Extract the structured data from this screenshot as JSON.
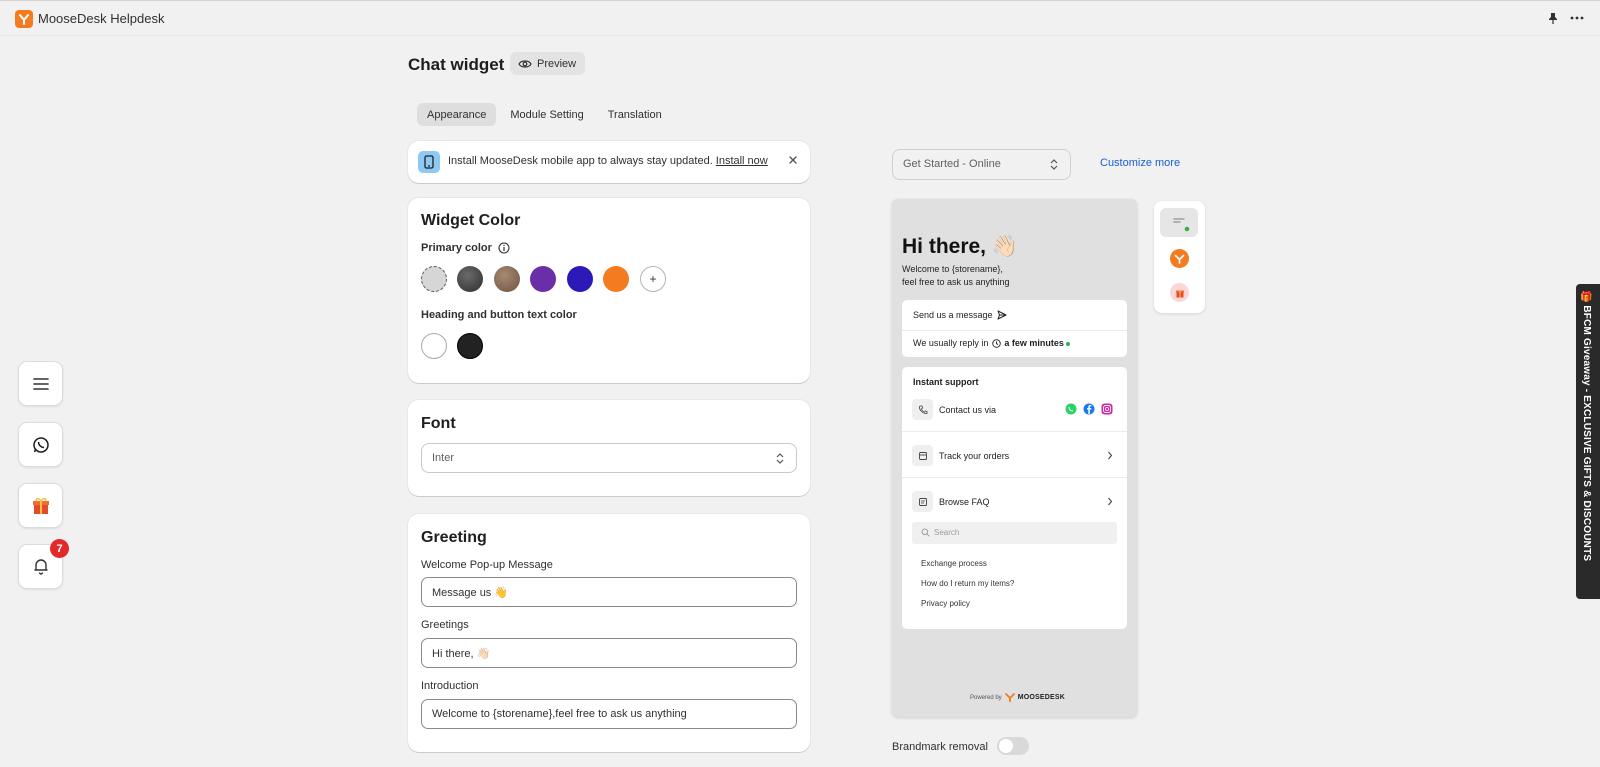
{
  "app": {
    "title": "MooseDesk Helpdesk"
  },
  "page": {
    "title": "Chat widget",
    "preview_label": "Preview"
  },
  "tabs": [
    {
      "label": "Appearance",
      "active": true
    },
    {
      "label": "Module Setting",
      "active": false
    },
    {
      "label": "Translation",
      "active": false
    }
  ],
  "banner": {
    "text": "Install MooseDesk mobile app to always stay updated.",
    "link": "Install now"
  },
  "widget_color": {
    "title": "Widget Color",
    "primary_label": "Primary color",
    "primary_colors": [
      "#d6d6d6",
      "#4a4a4a",
      "#8b6b52",
      "#6a2fa8",
      "#2a1ab8",
      "#f47b20"
    ],
    "text_color_label": "Heading and button text color",
    "text_colors": [
      "#ffffff",
      "#222222"
    ]
  },
  "font": {
    "title": "Font",
    "value": "Inter"
  },
  "greeting": {
    "title": "Greeting",
    "popup_label": "Welcome Pop-up Message",
    "popup_value": "Message us 👋",
    "greetings_label": "Greetings",
    "greetings_value": "Hi there, 👋🏻",
    "intro_label": "Introduction",
    "intro_value": "Welcome to {storename},feel free to ask us anything"
  },
  "status_select": {
    "value": "Get Started - Online"
  },
  "customize_link": "Customize more",
  "widget_preview": {
    "greeting": "Hi there, 👋🏻",
    "welcome_line1": "Welcome to {storename},",
    "welcome_line2": "feel free to ask us anything",
    "send_message": "Send us a message",
    "reply_prefix": "We usually reply in",
    "reply_time": "a few minutes",
    "instant_support": "Instant support",
    "contact_via": "Contact us via",
    "track_orders": "Track your orders",
    "browse_faq": "Browse FAQ",
    "search_placeholder": "Search",
    "faq_items": [
      "Exchange process",
      "How do I return my items?",
      "Privacy policy"
    ],
    "powered_by": "Powered by",
    "brand": "MOOSEDESK"
  },
  "brandmark": {
    "label": "Brandmark removal",
    "enabled": false
  },
  "notifications": {
    "count": "7"
  },
  "giveaway": {
    "text": "🎁 BFCM Giveaway - EXCLUSIVE GIFTS & DISCOUNTS"
  }
}
